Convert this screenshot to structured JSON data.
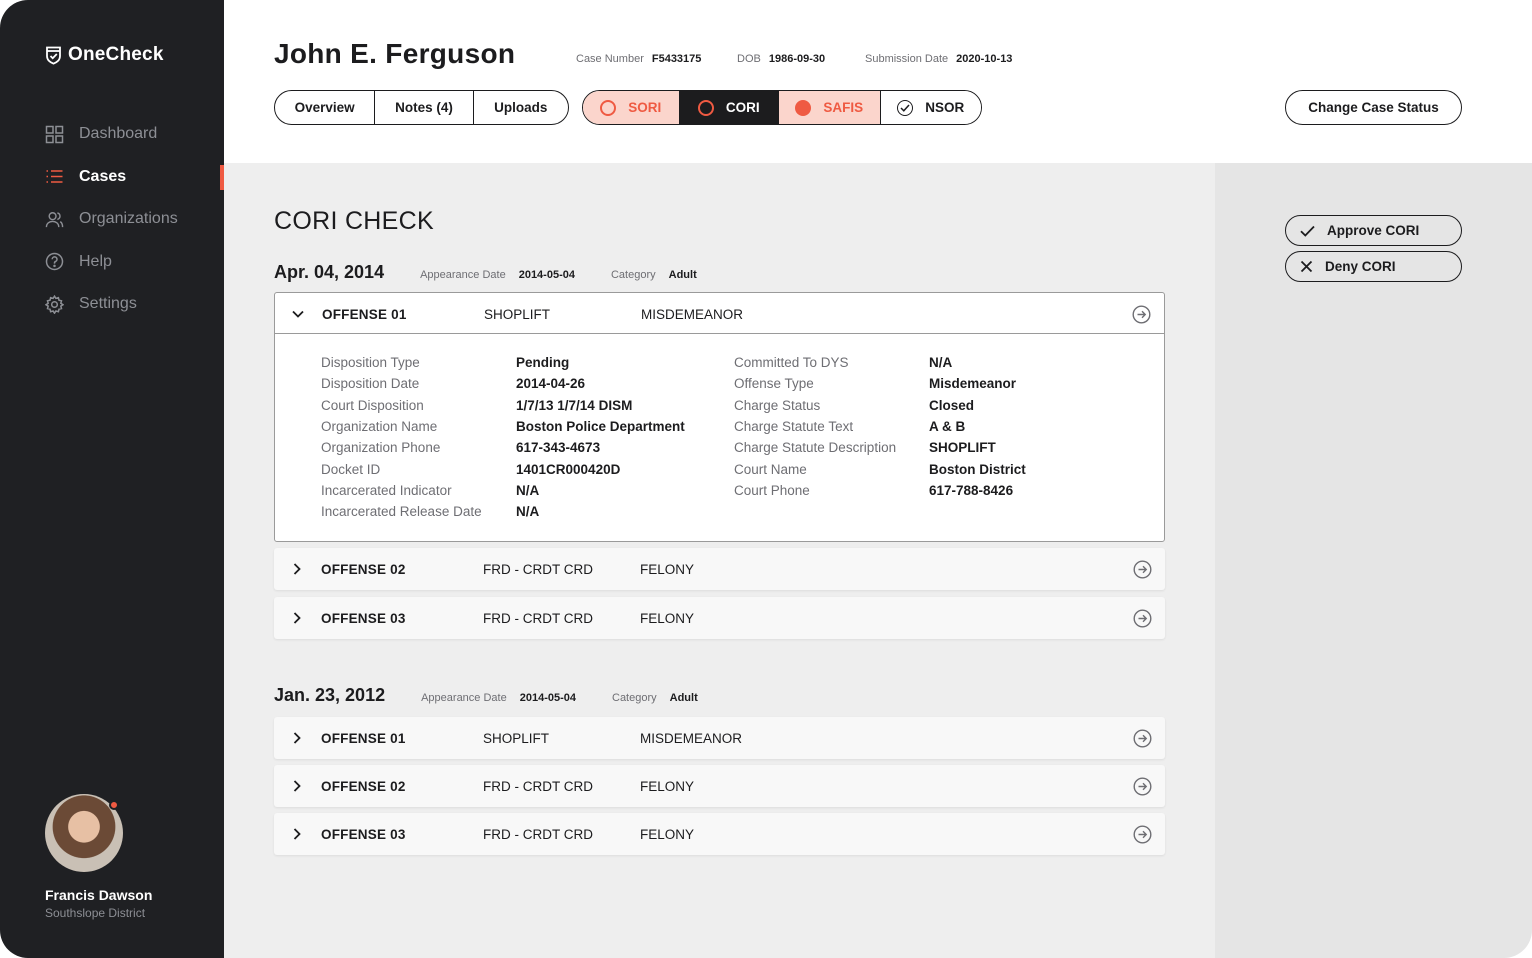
{
  "app": {
    "name": "OneCheck"
  },
  "sidebar": {
    "items": [
      {
        "label": "Dashboard",
        "icon": "grid-icon",
        "active": false
      },
      {
        "label": "Cases",
        "icon": "list-icon",
        "active": true
      },
      {
        "label": "Organizations",
        "icon": "users-icon",
        "active": false
      },
      {
        "label": "Help",
        "icon": "help-icon",
        "active": false
      },
      {
        "label": "Settings",
        "icon": "gear-icon",
        "active": false
      }
    ],
    "profile": {
      "name": "Francis Dawson",
      "org": "Southslope District"
    }
  },
  "header": {
    "person_name": "John E. Ferguson",
    "meta": [
      {
        "key": "Case Number",
        "value": "F5433175"
      },
      {
        "key": "DOB",
        "value": "1986-09-30"
      },
      {
        "key": "Submission Date",
        "value": "2020-10-13"
      }
    ],
    "tabs": [
      "Overview",
      "Notes (4)",
      "Uploads"
    ],
    "checks": [
      {
        "label": "SORI",
        "state": "pending-outline"
      },
      {
        "label": "CORI",
        "state": "active"
      },
      {
        "label": "SAFIS",
        "state": "flagged"
      },
      {
        "label": "NSOR",
        "state": "approved"
      }
    ],
    "change_status_label": "Change Case Status"
  },
  "actions": {
    "approve_label": "Approve CORI",
    "deny_label": "Deny CORI"
  },
  "main": {
    "title": "CORI CHECK",
    "groups": [
      {
        "date": "Apr. 04, 2014",
        "appearance_label": "Appearance Date",
        "appearance_value": "2014-05-04",
        "category_label": "Category",
        "category_value": "Adult",
        "offenses": [
          {
            "number": "OFFENSE 01",
            "description": "SHOPLIFT",
            "class": "MISDEMEANOR",
            "expanded": true
          },
          {
            "number": "OFFENSE 02",
            "description": "FRD - CRDT CRD",
            "class": "FELONY",
            "expanded": false
          },
          {
            "number": "OFFENSE 03",
            "description": "FRD - CRDT CRD",
            "class": "FELONY",
            "expanded": false
          }
        ],
        "details_left": [
          {
            "key": "Disposition Type",
            "value": "Pending"
          },
          {
            "key": "Disposition Date",
            "value": "2014-04-26"
          },
          {
            "key": "Court Disposition",
            "value": "1/7/13 1/7/14 DISM"
          },
          {
            "key": "Organization Name",
            "value": "Boston Police Department"
          },
          {
            "key": "Organization Phone",
            "value": "617-343-4673"
          },
          {
            "key": "Docket ID",
            "value": "1401CR000420D"
          },
          {
            "key": "Incarcerated Indicator",
            "value": "N/A"
          },
          {
            "key": "Incarcerated Release Date",
            "value": "N/A"
          }
        ],
        "details_right": [
          {
            "key": "Committed To DYS",
            "value": "N/A"
          },
          {
            "key": "Offense Type",
            "value": "Misdemeanor"
          },
          {
            "key": "Charge Status",
            "value": "Closed"
          },
          {
            "key": "Charge Statute Text",
            "value": "A & B"
          },
          {
            "key": "Charge Statute Description",
            "value": "SHOPLIFT"
          },
          {
            "key": "Court Name",
            "value": "Boston District"
          },
          {
            "key": "Court Phone",
            "value": "617-788-8426"
          }
        ]
      },
      {
        "date": "Jan. 23, 2012",
        "appearance_label": "Appearance Date",
        "appearance_value": "2014-05-04",
        "category_label": "Category",
        "category_value": "Adult",
        "offenses": [
          {
            "number": "OFFENSE 01",
            "description": "SHOPLIFT",
            "class": "MISDEMEANOR",
            "expanded": false
          },
          {
            "number": "OFFENSE 02",
            "description": "FRD - CRDT CRD",
            "class": "FELONY",
            "expanded": false
          },
          {
            "number": "OFFENSE 03",
            "description": "FRD - CRDT CRD",
            "class": "FELONY",
            "expanded": false
          }
        ]
      }
    ]
  },
  "colors": {
    "accent": "#ef5a42",
    "sidebar": "#1f2023",
    "accent_soft": "#fbd5cc"
  }
}
